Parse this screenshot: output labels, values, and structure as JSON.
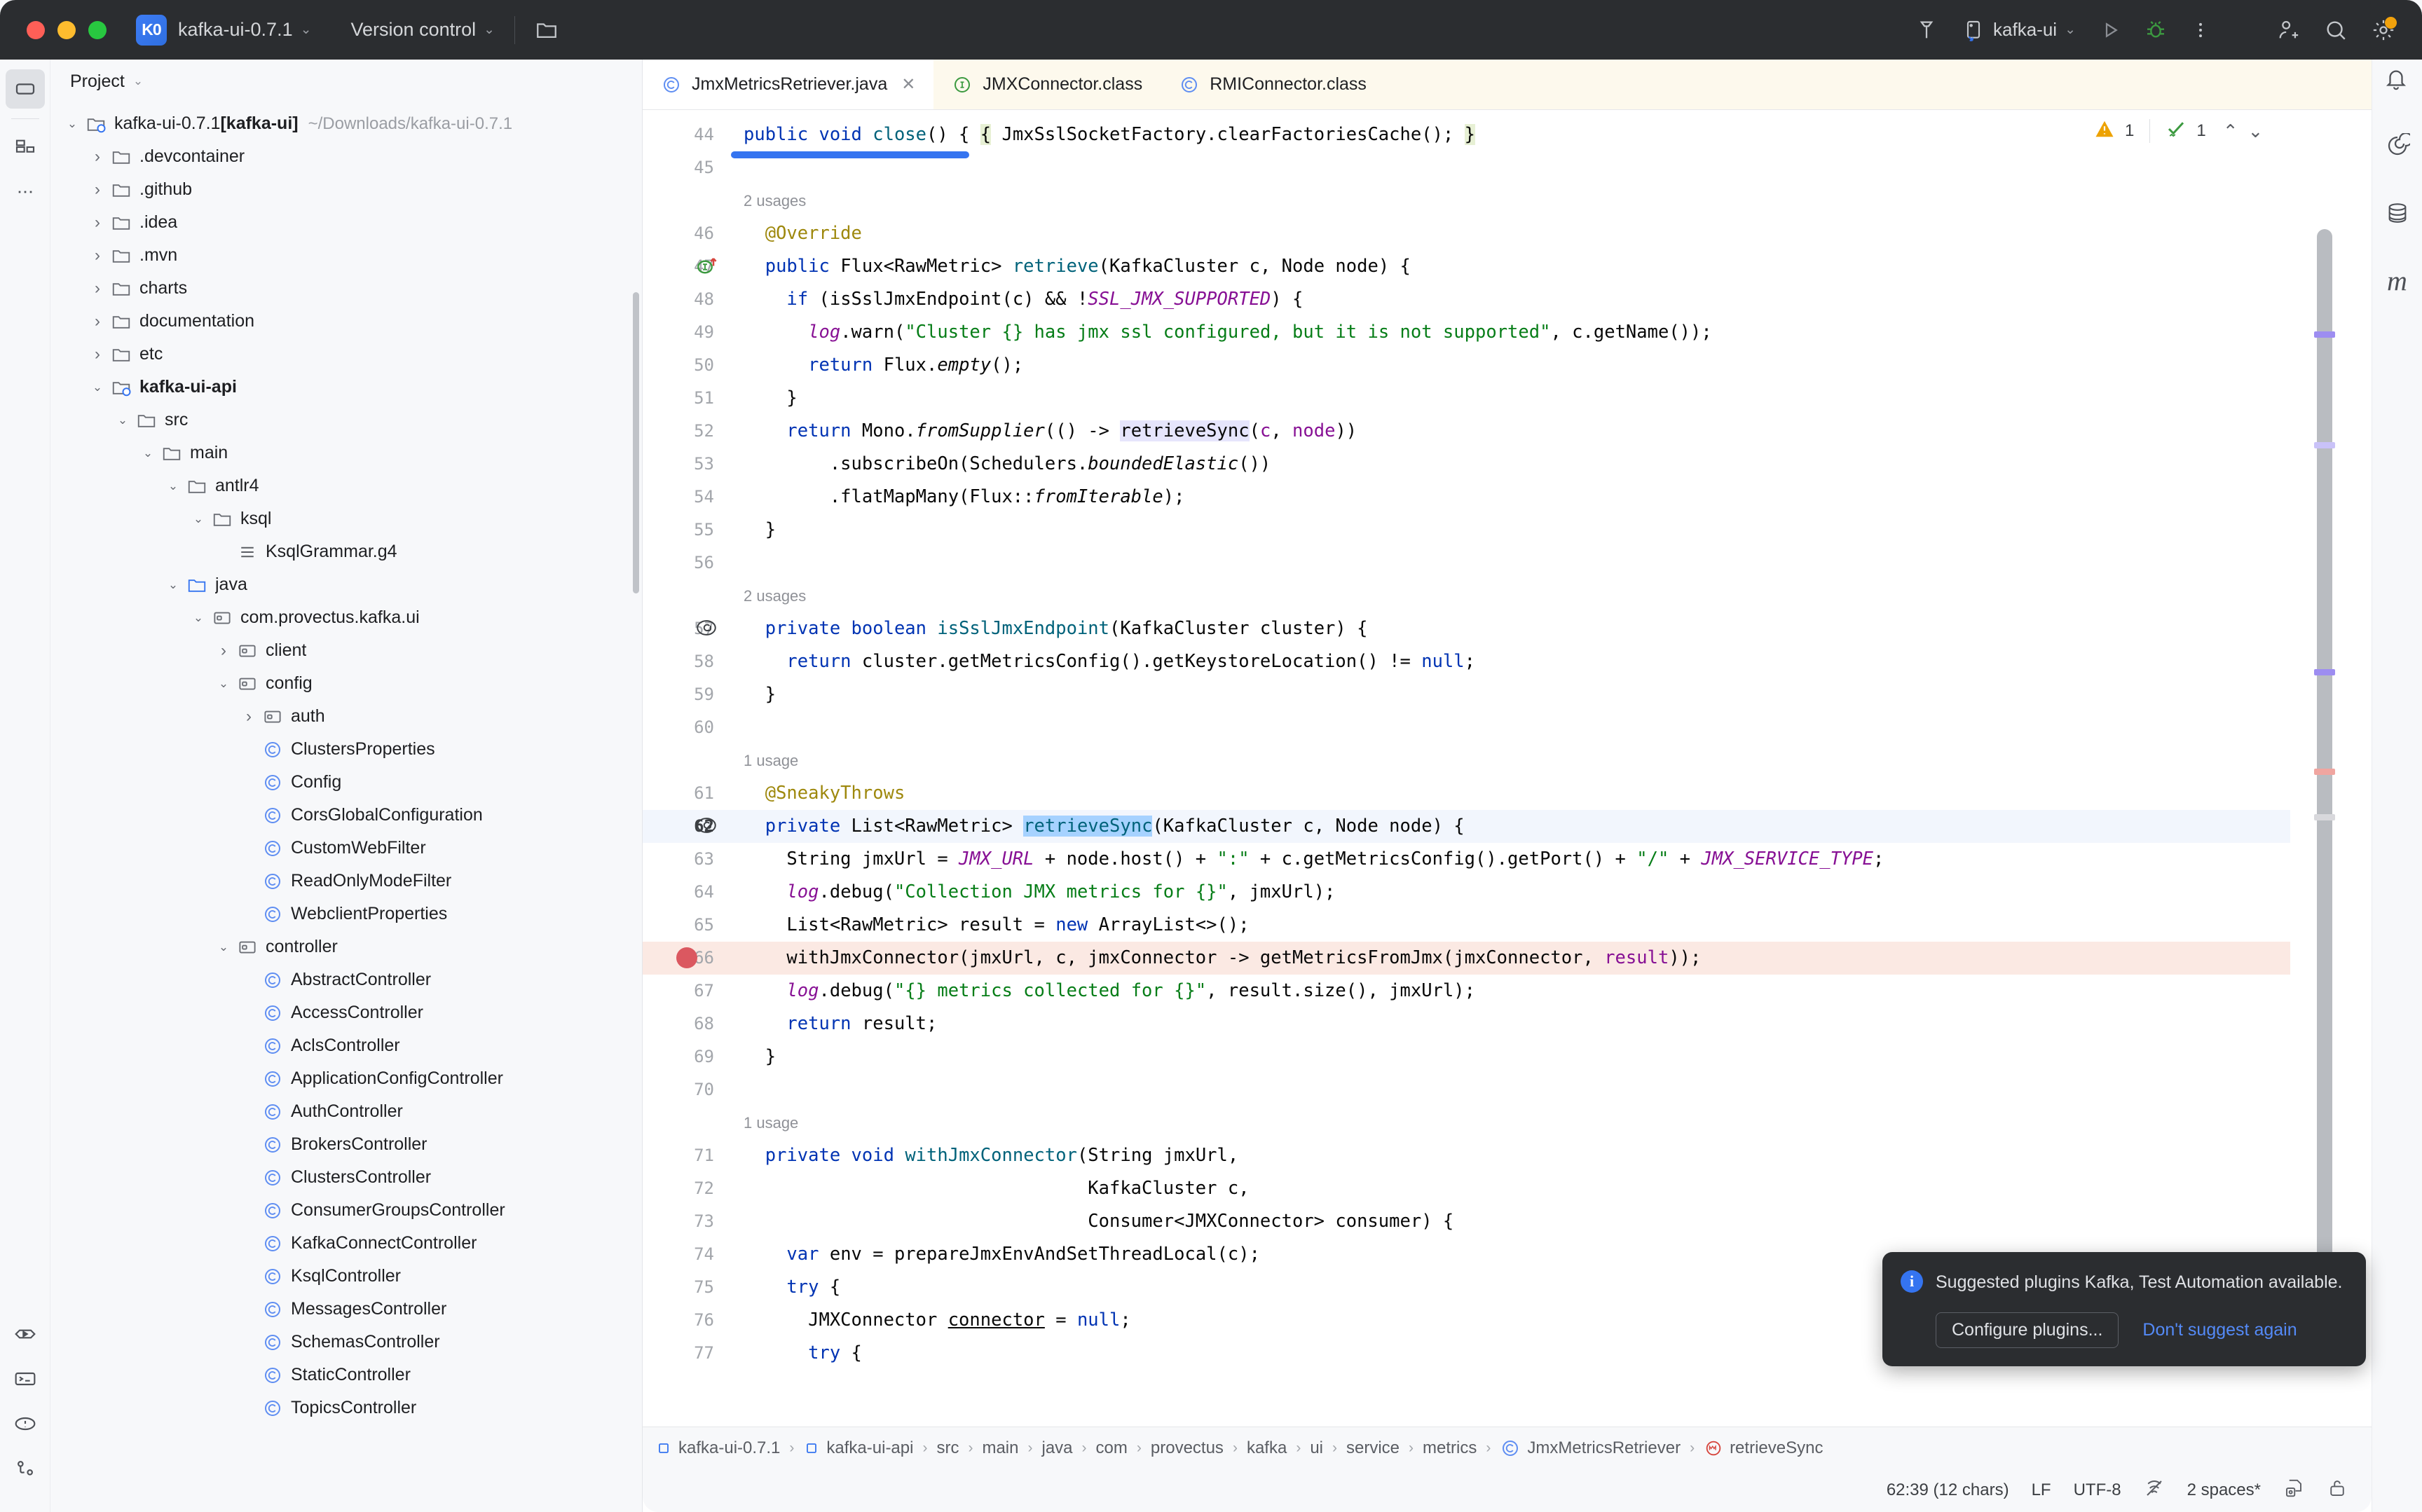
{
  "titlebar": {
    "project_badge": "K0",
    "project_name": "kafka-ui-0.7.1",
    "vcs_label": "Version control",
    "run_config": "kafka-ui",
    "icons": {
      "folder": "folder-icon",
      "build": "hammer-icon",
      "run": "run-icon",
      "debug": "debug-icon",
      "more": "more-vertical-icon",
      "add_user": "add-user-icon",
      "search": "search-icon",
      "settings": "settings-gear-icon"
    }
  },
  "left_rail": {
    "top": [
      "project-icon",
      "commit-icon",
      "more-icon"
    ],
    "bottom": [
      "run-icon",
      "terminal-icon",
      "problems-icon",
      "git-icon"
    ]
  },
  "right_rail": {
    "items": [
      "ai-assistant-icon",
      "database-icon",
      "maven-icon"
    ]
  },
  "panel": {
    "title": "Project",
    "tree": [
      {
        "depth": 0,
        "arrow": "down",
        "icon": "module-folder",
        "label": "kafka-ui-0.7.1",
        "bold_suffix": "[kafka-ui]",
        "path": "~/Downloads/kafka-ui-0.7.1"
      },
      {
        "depth": 1,
        "arrow": "right",
        "icon": "folder",
        "label": ".devcontainer"
      },
      {
        "depth": 1,
        "arrow": "right",
        "icon": "folder",
        "label": ".github"
      },
      {
        "depth": 1,
        "arrow": "right",
        "icon": "folder",
        "label": ".idea"
      },
      {
        "depth": 1,
        "arrow": "right",
        "icon": "folder",
        "label": ".mvn"
      },
      {
        "depth": 1,
        "arrow": "right",
        "icon": "folder",
        "label": "charts"
      },
      {
        "depth": 1,
        "arrow": "right",
        "icon": "folder",
        "label": "documentation"
      },
      {
        "depth": 1,
        "arrow": "right",
        "icon": "folder",
        "label": "etc"
      },
      {
        "depth": 1,
        "arrow": "down",
        "icon": "module-folder",
        "label": "kafka-ui-api",
        "bold": true
      },
      {
        "depth": 2,
        "arrow": "down",
        "icon": "folder",
        "label": "src"
      },
      {
        "depth": 3,
        "arrow": "down",
        "icon": "folder",
        "label": "main"
      },
      {
        "depth": 4,
        "arrow": "down",
        "icon": "folder",
        "label": "antlr4"
      },
      {
        "depth": 5,
        "arrow": "down",
        "icon": "folder",
        "label": "ksql"
      },
      {
        "depth": 6,
        "arrow": "none",
        "icon": "file-text",
        "label": "KsqlGrammar.g4"
      },
      {
        "depth": 4,
        "arrow": "down",
        "icon": "source-folder",
        "label": "java"
      },
      {
        "depth": 5,
        "arrow": "down",
        "icon": "package",
        "label": "com.provectus.kafka.ui"
      },
      {
        "depth": 6,
        "arrow": "right",
        "icon": "package",
        "label": "client"
      },
      {
        "depth": 6,
        "arrow": "down",
        "icon": "package",
        "label": "config"
      },
      {
        "depth": 7,
        "arrow": "right",
        "icon": "package",
        "label": "auth"
      },
      {
        "depth": 7,
        "arrow": "none",
        "icon": "class",
        "label": "ClustersProperties"
      },
      {
        "depth": 7,
        "arrow": "none",
        "icon": "class",
        "label": "Config"
      },
      {
        "depth": 7,
        "arrow": "none",
        "icon": "class",
        "label": "CorsGlobalConfiguration"
      },
      {
        "depth": 7,
        "arrow": "none",
        "icon": "class",
        "label": "CustomWebFilter"
      },
      {
        "depth": 7,
        "arrow": "none",
        "icon": "class",
        "label": "ReadOnlyModeFilter"
      },
      {
        "depth": 7,
        "arrow": "none",
        "icon": "class",
        "label": "WebclientProperties"
      },
      {
        "depth": 6,
        "arrow": "down",
        "icon": "package",
        "label": "controller"
      },
      {
        "depth": 7,
        "arrow": "none",
        "icon": "class",
        "label": "AbstractController"
      },
      {
        "depth": 7,
        "arrow": "none",
        "icon": "class",
        "label": "AccessController"
      },
      {
        "depth": 7,
        "arrow": "none",
        "icon": "class",
        "label": "AclsController"
      },
      {
        "depth": 7,
        "arrow": "none",
        "icon": "class",
        "label": "ApplicationConfigController"
      },
      {
        "depth": 7,
        "arrow": "none",
        "icon": "class",
        "label": "AuthController"
      },
      {
        "depth": 7,
        "arrow": "none",
        "icon": "class",
        "label": "BrokersController"
      },
      {
        "depth": 7,
        "arrow": "none",
        "icon": "class",
        "label": "ClustersController"
      },
      {
        "depth": 7,
        "arrow": "none",
        "icon": "class",
        "label": "ConsumerGroupsController"
      },
      {
        "depth": 7,
        "arrow": "none",
        "icon": "class",
        "label": "KafkaConnectController"
      },
      {
        "depth": 7,
        "arrow": "none",
        "icon": "class",
        "label": "KsqlController"
      },
      {
        "depth": 7,
        "arrow": "none",
        "icon": "class",
        "label": "MessagesController"
      },
      {
        "depth": 7,
        "arrow": "none",
        "icon": "class",
        "label": "SchemasController"
      },
      {
        "depth": 7,
        "arrow": "none",
        "icon": "class",
        "label": "StaticController"
      },
      {
        "depth": 7,
        "arrow": "none",
        "icon": "class",
        "label": "TopicsController"
      }
    ]
  },
  "tabs": [
    {
      "label": "JmxMetricsRetriever.java",
      "icon": "class-icon",
      "active": true,
      "closable": true
    },
    {
      "label": "JMXConnector.class",
      "icon": "interface-icon",
      "active": false,
      "closable": false
    },
    {
      "label": "RMIConnector.class",
      "icon": "class-icon",
      "active": false,
      "closable": false
    }
  ],
  "inspection": {
    "warning_count": "1",
    "ok_count": "1",
    "up_icon": "chevron-up-icon",
    "down_icon": "chevron-down-icon"
  },
  "editor": {
    "first_visible_line": 44,
    "caret_line": 62,
    "breakpoint_line": 66,
    "lines": [
      {
        "n": 44,
        "partial": true,
        "html": "<span class=\"kw\">public void </span><span class=\"mth\">close</span>() { <span class=\"brc\">{</span> JmxSslSocketFactory.clearFactoriesCache(); <span class=\"brc\">}</span>"
      },
      {
        "n": 45,
        "html": ""
      },
      {
        "n": null,
        "usage": "2 usages"
      },
      {
        "n": 46,
        "html": "  <span class=\"anno\">@Override</span>"
      },
      {
        "n": 47,
        "gutter": "override-icon",
        "html": "  <span class=\"kw\">public </span>Flux&lt;RawMetric&gt; <span class=\"mth\">retrieve</span>(KafkaCluster c, Node node) {"
      },
      {
        "n": 48,
        "html": "    <span class=\"kw\">if </span>(isSslJmxEndpoint(c) &amp;&amp; !<span class=\"stat\">SSL_JMX_SUPPORTED</span>) {"
      },
      {
        "n": 49,
        "html": "      <span class=\"fld\">log</span>.warn(<span class=\"str\">\"Cluster {} has jmx ssl configured, but it is not supported\"</span>, c.getName());"
      },
      {
        "n": 50,
        "html": "      <span class=\"kw\">return </span>Flux.<span class=\"ital\">empty</span>();"
      },
      {
        "n": 51,
        "html": "    }"
      },
      {
        "n": 52,
        "html": "    <span class=\"kw\">return </span>Mono.<span class=\"ital\">fromSupplier</span>(() -&gt; <span class=\"hl\">retrieveSync</span>(<span class=\"param\">c</span>, <span class=\"param\">node</span>))"
      },
      {
        "n": 53,
        "html": "        .subscribeOn(Schedulers.<span class=\"ital\">boundedElastic</span>())"
      },
      {
        "n": 54,
        "html": "        .flatMapMany(Flux::<span class=\"ital\">fromIterable</span>);"
      },
      {
        "n": 55,
        "html": "  }"
      },
      {
        "n": 56,
        "html": ""
      },
      {
        "n": null,
        "usage": "2 usages"
      },
      {
        "n": 57,
        "gutter": "annotation-icon",
        "html": "  <span class=\"kw\">private boolean </span><span class=\"mth\">isSslJmxEndpoint</span>(KafkaCluster cluster) {"
      },
      {
        "n": 58,
        "html": "    <span class=\"kw\">return </span>cluster.getMetricsConfig().getKeystoreLocation() != <span class=\"kw\">null</span>;"
      },
      {
        "n": 59,
        "html": "  }"
      },
      {
        "n": 60,
        "html": ""
      },
      {
        "n": null,
        "usage": "1 usage"
      },
      {
        "n": 61,
        "html": "  <span class=\"anno\">@SneakyThrows</span>"
      },
      {
        "n": 62,
        "gutter": "annotation-icon",
        "caret": true,
        "html": "  <span class=\"kw\">private </span>List&lt;RawMetric&gt; <span class=\"sel\"><span class=\"mth\">retrieveSync</span></span>(KafkaCluster c, Node node) {"
      },
      {
        "n": 63,
        "html": "    String jmxUrl = <span class=\"stat\">JMX_URL</span> + node.host() + <span class=\"str\">\":\"</span> + c.getMetricsConfig().getPort() + <span class=\"str\">\"/\"</span> + <span class=\"stat\">JMX_SERVICE_TYPE</span>;"
      },
      {
        "n": 64,
        "html": "    <span class=\"fld\">log</span>.debug(<span class=\"str\">\"Collection JMX metrics for {}\"</span>, jmxUrl);"
      },
      {
        "n": 65,
        "html": "    List&lt;RawMetric&gt; result = <span class=\"kw\">new </span>ArrayList&lt;&gt;();"
      },
      {
        "n": 66,
        "breakpoint": true,
        "html": "    withJmxConnector(jmxUrl, c, jmxConnector -&gt; getMetricsFromJmx(jmxConnector, <span class=\"param\">result</span>));"
      },
      {
        "n": 67,
        "html": "    <span class=\"fld\">log</span>.debug(<span class=\"str\">\"{} metrics collected for {}\"</span>, result.size(), jmxUrl);"
      },
      {
        "n": 68,
        "html": "    <span class=\"kw\">return </span>result;"
      },
      {
        "n": 69,
        "html": "  }"
      },
      {
        "n": 70,
        "html": ""
      },
      {
        "n": null,
        "usage": "1 usage"
      },
      {
        "n": 71,
        "html": "  <span class=\"kw\">private void </span><span class=\"mth\">withJmxConnector</span>(String jmxUrl,"
      },
      {
        "n": 72,
        "html": "                                KafkaCluster c,"
      },
      {
        "n": 73,
        "html": "                                Consumer&lt;JMXConnector&gt; consumer) {"
      },
      {
        "n": 74,
        "html": "    <span class=\"kw\">var </span>env = prepareJmxEnvAndSetThreadLocal(c);"
      },
      {
        "n": 75,
        "html": "    <span class=\"kw\">try </span>{"
      },
      {
        "n": 76,
        "html": "      JMXConnector <span class=\"und\">connector</span> = <span class=\"kw\">null</span>;"
      },
      {
        "n": 77,
        "html": "      <span class=\"kw\">try </span>{"
      }
    ]
  },
  "breadcrumbs": [
    {
      "label": "kafka-ui-0.7.1",
      "icon": "module-icon"
    },
    {
      "label": "kafka-ui-api",
      "icon": "module-icon"
    },
    {
      "label": "src"
    },
    {
      "label": "main"
    },
    {
      "label": "java"
    },
    {
      "label": "com"
    },
    {
      "label": "provectus"
    },
    {
      "label": "kafka"
    },
    {
      "label": "ui"
    },
    {
      "label": "service"
    },
    {
      "label": "metrics"
    },
    {
      "label": "JmxMetricsRetriever",
      "icon": "class-icon"
    },
    {
      "label": "retrieveSync",
      "icon": "method-icon"
    }
  ],
  "status": {
    "position": "62:39 (12 chars)",
    "line_sep": "LF",
    "encoding": "UTF-8",
    "indent": "2 spaces*",
    "icons": [
      "inspections-icon",
      "indent-config-icon",
      "lock-icon"
    ]
  },
  "notification": {
    "icon": "info-icon",
    "message": "Suggested plugins Kafka, Test Automation available.",
    "primary_button": "Configure plugins...",
    "secondary_link": "Don't suggest again"
  },
  "colors": {
    "accent": "#3574f0",
    "titlebar_bg": "#2b2d30",
    "panel_bg": "#f7f8fa",
    "editor_bg": "#ffffff",
    "tab_inactive_bg": "#fdf9ed",
    "breakpoint_row": "#fbe9e3",
    "caret_row": "#f2f6fd",
    "selection": "#a6d2ff",
    "keyword": "#0033b3",
    "string": "#067d17",
    "annotation": "#9e880d",
    "static_field": "#871094",
    "method": "#00627a",
    "warning": "#eda200",
    "ok": "#3c9a40",
    "breakpoint": "#db5860"
  }
}
